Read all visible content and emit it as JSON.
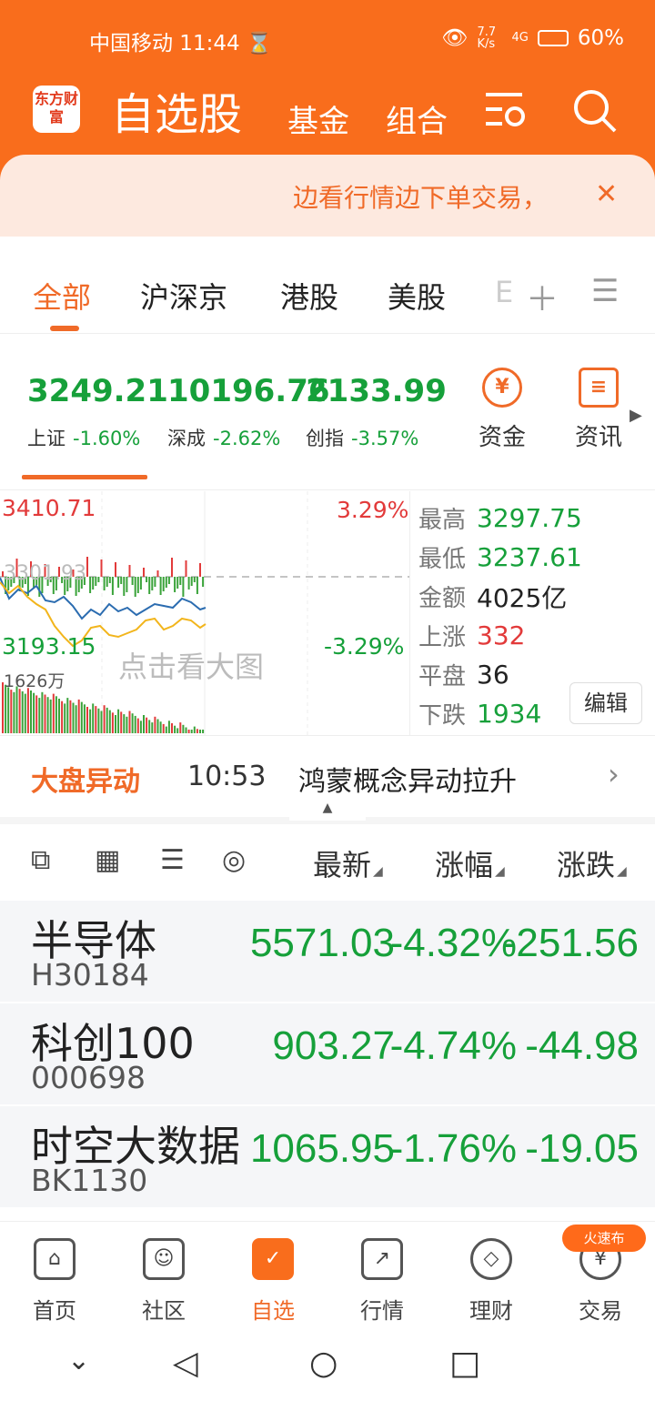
{
  "status": {
    "carrier": "中国移动 11:44 ⌛",
    "speed": "7.7 K/s",
    "network": "4G",
    "battery": "60%"
  },
  "header": {
    "logo": "东方财富",
    "title": "自选股",
    "nav": [
      "基金",
      "组合"
    ]
  },
  "banner": {
    "text": "边看行情边下单交易，"
  },
  "tabs": [
    "全部",
    "沪深京",
    "港股",
    "美股",
    "E"
  ],
  "indices": [
    {
      "value": "3249.21",
      "name": "上证",
      "change": "-1.60%"
    },
    {
      "value": "10196.76",
      "name": "深成",
      "change": "-2.62%"
    },
    {
      "value": "2133.99",
      "name": "创指",
      "change": "-3.57%"
    }
  ],
  "quick_buttons": [
    "资金",
    "资讯"
  ],
  "minichart": {
    "high_label": "3410.71",
    "low_label": "3193.15",
    "pct_up": "3.29%",
    "pct_down": "-3.29%",
    "volume": "1626万",
    "mid_label": "3301.93",
    "overlay": "点击看大图"
  },
  "stats": [
    {
      "k": "最高",
      "v": "3297.75",
      "color": "#16a03a"
    },
    {
      "k": "最低",
      "v": "3237.61",
      "color": "#16a03a"
    },
    {
      "k": "金额",
      "v": "4025亿",
      "color": "#222"
    },
    {
      "k": "上涨",
      "v": "332",
      "color": "#e23a3a"
    },
    {
      "k": "平盘",
      "v": "36",
      "color": "#222"
    },
    {
      "k": "下跌",
      "v": "1934",
      "color": "#16a03a"
    }
  ],
  "edit_label": "编辑",
  "alert": {
    "title": "大盘异动",
    "time": "10:53",
    "text": "鸿蒙概念异动拉升"
  },
  "list_header": {
    "latest": "最新",
    "pct": "涨幅",
    "change": "涨跌"
  },
  "rows": [
    {
      "name": "半导体",
      "code": "H30184",
      "latest": "5571.03",
      "pct": "-4.32%",
      "chg": "-251.56"
    },
    {
      "name": "科创100",
      "code": "000698",
      "latest": "903.27",
      "pct": "-4.74%",
      "chg": "-44.98"
    },
    {
      "name": "时空大数据",
      "code": "BK1130",
      "latest": "1065.95",
      "pct": "-1.76%",
      "chg": "-19.05"
    }
  ],
  "bottom_nav": [
    "首页",
    "社区",
    "自选",
    "行情",
    "理财",
    "交易"
  ],
  "hot_badge": "火速布",
  "colors": {
    "brand": "#f96d1c",
    "down": "#16a03a",
    "up": "#e23a3a"
  }
}
